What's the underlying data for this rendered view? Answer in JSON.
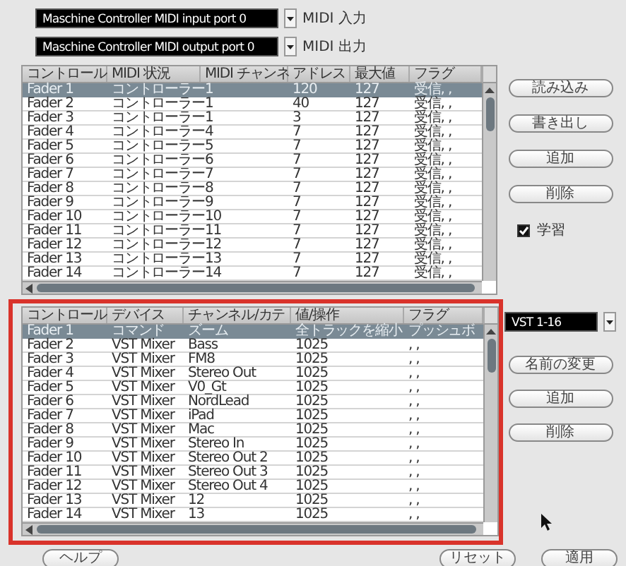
{
  "ports": [
    {
      "value": "Maschine Controller MIDI input port 0",
      "label": "MIDI 入力"
    },
    {
      "value": "Maschine Controller MIDI output port 0",
      "label": "MIDI 出力"
    }
  ],
  "upper_table": {
    "columns": [
      "コントロール",
      "MIDI 状況",
      "MIDI チャンネ",
      "アドレス",
      "最大値",
      "フラグ"
    ],
    "rows": [
      {
        "selected": true,
        "cells": [
          "Fader 1",
          "コントローラー",
          "1",
          "120",
          "127",
          "受信, ,"
        ]
      },
      {
        "selected": false,
        "cells": [
          "Fader 2",
          "コントローラー",
          "1",
          "40",
          "127",
          "受信, ,"
        ]
      },
      {
        "selected": false,
        "cells": [
          "Fader 3",
          "コントローラー",
          "1",
          "3",
          "127",
          "受信, ,"
        ]
      },
      {
        "selected": false,
        "cells": [
          "Fader 4",
          "コントローラー",
          "4",
          "7",
          "127",
          "受信, ,"
        ]
      },
      {
        "selected": false,
        "cells": [
          "Fader 5",
          "コントローラー",
          "5",
          "7",
          "127",
          "受信, ,"
        ]
      },
      {
        "selected": false,
        "cells": [
          "Fader 6",
          "コントローラー",
          "6",
          "7",
          "127",
          "受信, ,"
        ]
      },
      {
        "selected": false,
        "cells": [
          "Fader 7",
          "コントローラー",
          "7",
          "7",
          "127",
          "受信, ,"
        ]
      },
      {
        "selected": false,
        "cells": [
          "Fader 8",
          "コントローラー",
          "8",
          "7",
          "127",
          "受信, ,"
        ]
      },
      {
        "selected": false,
        "cells": [
          "Fader 9",
          "コントローラー",
          "9",
          "7",
          "127",
          "受信, ,"
        ]
      },
      {
        "selected": false,
        "cells": [
          "Fader 10",
          "コントローラー",
          "10",
          "7",
          "127",
          "受信, ,"
        ]
      },
      {
        "selected": false,
        "cells": [
          "Fader 11",
          "コントローラー",
          "11",
          "7",
          "127",
          "受信, ,"
        ]
      },
      {
        "selected": false,
        "cells": [
          "Fader 12",
          "コントローラー",
          "12",
          "7",
          "127",
          "受信, ,"
        ]
      },
      {
        "selected": false,
        "cells": [
          "Fader 13",
          "コントローラー",
          "13",
          "7",
          "127",
          "受信, ,"
        ]
      },
      {
        "selected": false,
        "cells": [
          "Fader 14",
          "コントローラー",
          "14",
          "7",
          "127",
          "受信, ,"
        ]
      }
    ]
  },
  "upper_buttons": [
    "読み込み",
    "書き出し",
    "追加",
    "削除"
  ],
  "learn": {
    "label": "学習",
    "checked": true
  },
  "bank": {
    "value": "VST 1-16"
  },
  "lower_table": {
    "columns": [
      "コントロール",
      "デバイス",
      "チャンネル/カテ",
      "値/操作",
      "フラグ"
    ],
    "rows": [
      {
        "selected": true,
        "cells": [
          "Fader 1",
          "コマンド",
          "ズーム",
          "全トラックを縮小",
          "プッシュボ"
        ]
      },
      {
        "selected": false,
        "cells": [
          "Fader 2",
          "VST Mixer",
          "Bass",
          "1025",
          ", ,"
        ]
      },
      {
        "selected": false,
        "cells": [
          "Fader 3",
          "VST Mixer",
          "FM8",
          "1025",
          ", ,"
        ]
      },
      {
        "selected": false,
        "cells": [
          "Fader 4",
          "VST Mixer",
          "Stereo Out",
          "1025",
          ", ,"
        ]
      },
      {
        "selected": false,
        "cells": [
          "Fader 5",
          "VST Mixer",
          "V0_Gt",
          "1025",
          ", ,"
        ]
      },
      {
        "selected": false,
        "cells": [
          "Fader 6",
          "VST Mixer",
          "NordLead",
          "1025",
          ", ,"
        ]
      },
      {
        "selected": false,
        "cells": [
          "Fader 7",
          "VST Mixer",
          "iPad",
          "1025",
          ", ,"
        ]
      },
      {
        "selected": false,
        "cells": [
          "Fader 8",
          "VST Mixer",
          "Mac",
          "1025",
          ", ,"
        ]
      },
      {
        "selected": false,
        "cells": [
          "Fader 9",
          "VST Mixer",
          "Stereo In",
          "1025",
          ", ,"
        ]
      },
      {
        "selected": false,
        "cells": [
          "Fader 10",
          "VST Mixer",
          "Stereo Out 2",
          "1025",
          ", ,"
        ]
      },
      {
        "selected": false,
        "cells": [
          "Fader 11",
          "VST Mixer",
          "Stereo Out 3",
          "1025",
          ", ,"
        ]
      },
      {
        "selected": false,
        "cells": [
          "Fader 12",
          "VST Mixer",
          "Stereo Out 4",
          "1025",
          ", ,"
        ]
      },
      {
        "selected": false,
        "cells": [
          "Fader 13",
          "VST Mixer",
          "12",
          "1025",
          ", ,"
        ]
      },
      {
        "selected": false,
        "cells": [
          "Fader 14",
          "VST Mixer",
          "13",
          "1025",
          ", ,"
        ]
      }
    ]
  },
  "lower_buttons": [
    "名前の変更",
    "追加",
    "削除"
  ],
  "footer_buttons": [
    "ヘルプ",
    "リセット",
    "適用"
  ]
}
